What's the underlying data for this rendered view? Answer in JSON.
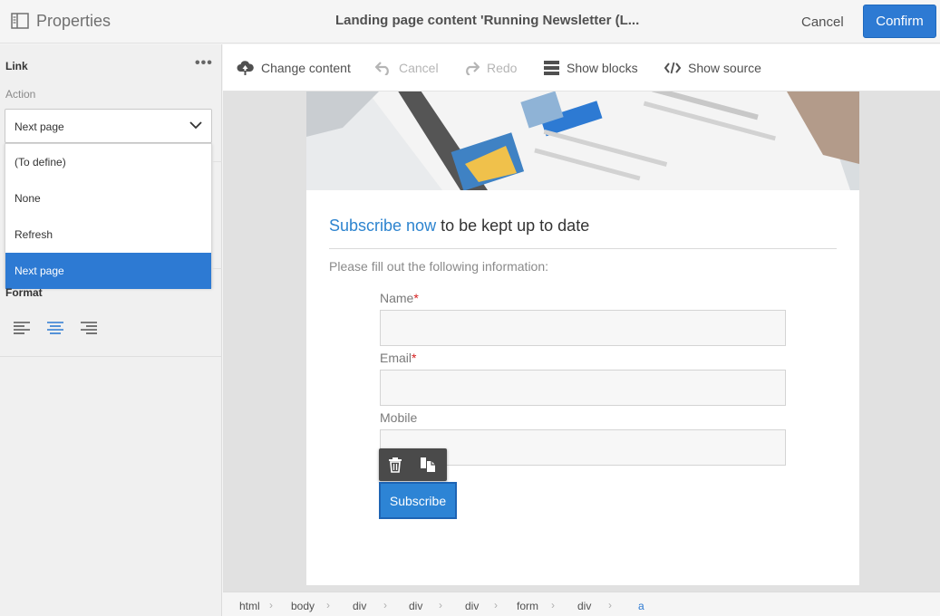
{
  "header": {
    "panel_title": "Properties",
    "document_title": "Landing page content 'Running Newsletter (L...",
    "cancel_label": "Cancel",
    "confirm_label": "Confirm"
  },
  "left_panel": {
    "section_title": "Link",
    "more_label": "•••",
    "action_label": "Action",
    "selected_action": "Next page",
    "options": [
      "(To define)",
      "None",
      "Refresh",
      "Next page"
    ],
    "format_label": "Format"
  },
  "toolbar": {
    "change_content": "Change content",
    "cancel": "Cancel",
    "redo": "Redo",
    "show_blocks": "Show blocks",
    "show_source": "Show source"
  },
  "content": {
    "heading_link": "Subscribe now",
    "heading_rest": " to be kept up to date",
    "intro": "Please fill out the following information:",
    "name_label": "Name",
    "email_label": "Email",
    "mobile_label": "Mobile",
    "required_mark": "*",
    "subscribe_label": "Subscribe"
  },
  "breadcrumb": [
    "html",
    "body",
    "div",
    "div",
    "div",
    "form",
    "div",
    "a"
  ],
  "colors": {
    "accent": "#2d7ad3",
    "link_blue": "#2d84cf",
    "required": "#d62020"
  }
}
